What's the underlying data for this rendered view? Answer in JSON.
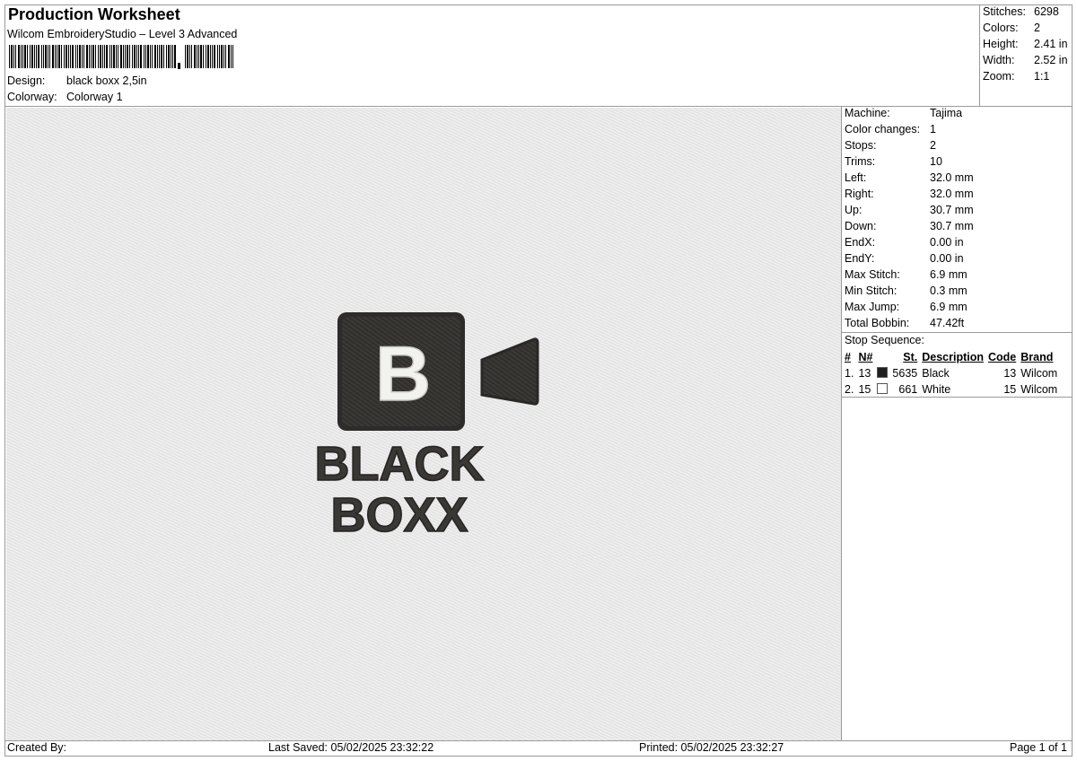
{
  "header": {
    "title": "Production Worksheet",
    "software": "Wilcom EmbroideryStudio – Level 3 Advanced",
    "design_label": "Design:",
    "design_value": "black boxx 2,5in",
    "colorway_label": "Colorway:",
    "colorway_value": "Colorway 1"
  },
  "summary": [
    {
      "label": "Stitches:",
      "value": "6298"
    },
    {
      "label": "Colors:",
      "value": "2"
    },
    {
      "label": "Height:",
      "value": "2.41 in"
    },
    {
      "label": "Width:",
      "value": "2.52 in"
    },
    {
      "label": "Zoom:",
      "value": "1:1"
    }
  ],
  "machine_info": [
    {
      "label": "Machine:",
      "value": "Tajima"
    },
    {
      "label": "Color changes:",
      "value": "1"
    },
    {
      "label": "Stops:",
      "value": "2"
    },
    {
      "label": "Trims:",
      "value": "10"
    },
    {
      "label": "Left:",
      "value": "32.0 mm"
    },
    {
      "label": "Right:",
      "value": "32.0 mm"
    },
    {
      "label": "Up:",
      "value": "30.7 mm"
    },
    {
      "label": "Down:",
      "value": "30.7 mm"
    },
    {
      "label": "EndX:",
      "value": "0.00 in"
    },
    {
      "label": "EndY:",
      "value": "0.00 in"
    },
    {
      "label": "Max Stitch:",
      "value": "6.9 mm"
    },
    {
      "label": "Min Stitch:",
      "value": "0.3 mm"
    },
    {
      "label": "Max Jump:",
      "value": "6.9 mm"
    },
    {
      "label": "Total Bobbin:",
      "value": "47.42ft"
    }
  ],
  "stop_sequence": {
    "title": "Stop Sequence:",
    "headers": [
      "#",
      "N#",
      "St.",
      "Description",
      "Code",
      "Brand"
    ],
    "rows": [
      {
        "num": "1.",
        "n": "13",
        "swatch": "#1e1e1e",
        "st": "5635",
        "desc": "Black",
        "code": "13",
        "brand": "Wilcom"
      },
      {
        "num": "2.",
        "n": "15",
        "swatch": "#ffffff",
        "st": "661",
        "desc": "White",
        "code": "15",
        "brand": "Wilcom"
      }
    ]
  },
  "design_art": {
    "letter": "B",
    "line1": "BLACK",
    "line2": "BOXX",
    "thread_dark": "#3a3835",
    "thread_light": "#f2f3ee"
  },
  "footer": {
    "created_by": "Created By:",
    "last_saved": "Last Saved: 05/02/2025 23:32:22",
    "printed": "Printed: 05/02/2025 23:32:27",
    "page": "Page 1 of 1"
  }
}
